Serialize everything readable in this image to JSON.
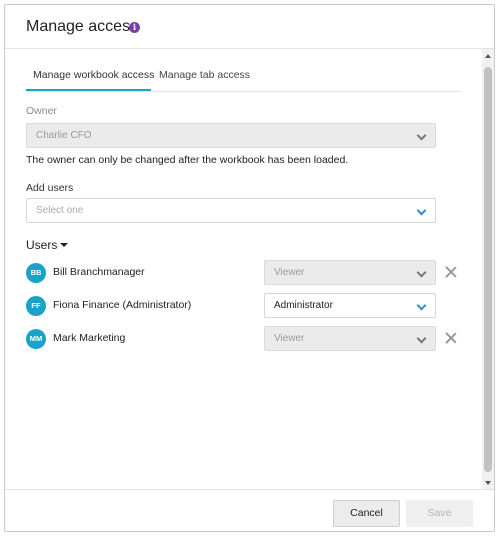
{
  "dialog": {
    "title": "Manage access",
    "info_icon": "info-icon"
  },
  "tabs": [
    {
      "label": "Manage workbook access",
      "active": true
    },
    {
      "label": "Manage tab access",
      "active": false
    }
  ],
  "owner": {
    "label": "Owner",
    "value": "Charlie CFO",
    "disabled": true,
    "note": "The owner can only be changed after the workbook has been loaded."
  },
  "add_users": {
    "label": "Add users",
    "placeholder": "Select one"
  },
  "users": {
    "heading": "Users",
    "list": [
      {
        "initials": "BB",
        "name": "Bill Branchmanager",
        "role": "Viewer",
        "role_disabled": true,
        "removable": true
      },
      {
        "initials": "FF",
        "name": "Fiona Finance (Administrator)",
        "role": "Administrator",
        "role_disabled": false,
        "removable": false
      },
      {
        "initials": "MM",
        "name": "Mark Marketing",
        "role": "Viewer",
        "role_disabled": true,
        "removable": true
      }
    ]
  },
  "footer": {
    "cancel_label": "Cancel",
    "save_label": "Save",
    "save_disabled": true
  },
  "colors": {
    "accent": "#1aa3c8",
    "info_icon": "#7a3ea8",
    "chevron": "#2a8fc7"
  }
}
